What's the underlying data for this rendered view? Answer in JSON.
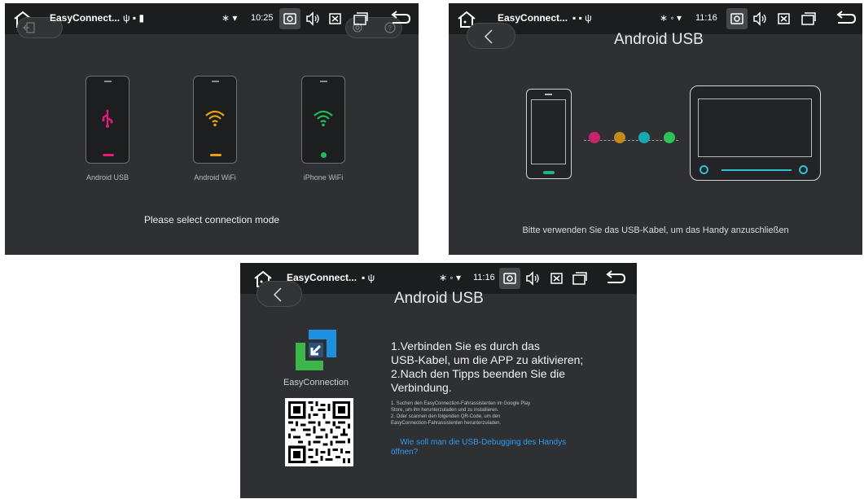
{
  "status": {
    "app_title": "EasyConnect...",
    "screen1_time": "10:25",
    "screen23_time": "11:16"
  },
  "screen1": {
    "modes": [
      {
        "label": "Android USB",
        "color": "#e6197d",
        "icon": "usb-icon"
      },
      {
        "label": "Android WiFi",
        "color": "#e6a117",
        "icon": "wifi-icon"
      },
      {
        "label": "iPhone WiFi",
        "color": "#22b85d",
        "icon": "wifi-icon"
      }
    ],
    "prompt": "Please select connection mode"
  },
  "screen2": {
    "title": "Android USB",
    "hint": "Bitte verwenden Sie das USB-Kabel, um das Handy anzuschließen",
    "app_dots": [
      "#c9236b",
      "#c08b1a",
      "#1aa7b4",
      "#2cc354"
    ]
  },
  "screen3": {
    "title": "Android USB",
    "logo_label": "EasyConnection",
    "instructions_main": [
      "1.Verbinden Sie es durch das",
      "USB-Kabel, um die APP zu aktivieren;",
      "2.Nach den Tipps beenden Sie die",
      "Verbindung."
    ],
    "instructions_small": [
      "1. Suchen den EasyConnection-Fahrassistenten im Google Play",
      "Store, um ihn herunterzuladen und zu installieren.",
      "2. Oder scannen den folgenden QR-Code, um den",
      "EasyConnection-Fahrassistenten herunterzuladen."
    ],
    "debug_link": [
      "    Wie soll man die USB-Debugging des Handys",
      "öffnen?"
    ]
  },
  "colors": {
    "panel_bg": "#2f3033",
    "statusbar_bg": "#1c1d1f",
    "link_blue": "#2e9bf0",
    "accent_teal": "#2cc3cf",
    "accent_green": "#1fb77a"
  }
}
